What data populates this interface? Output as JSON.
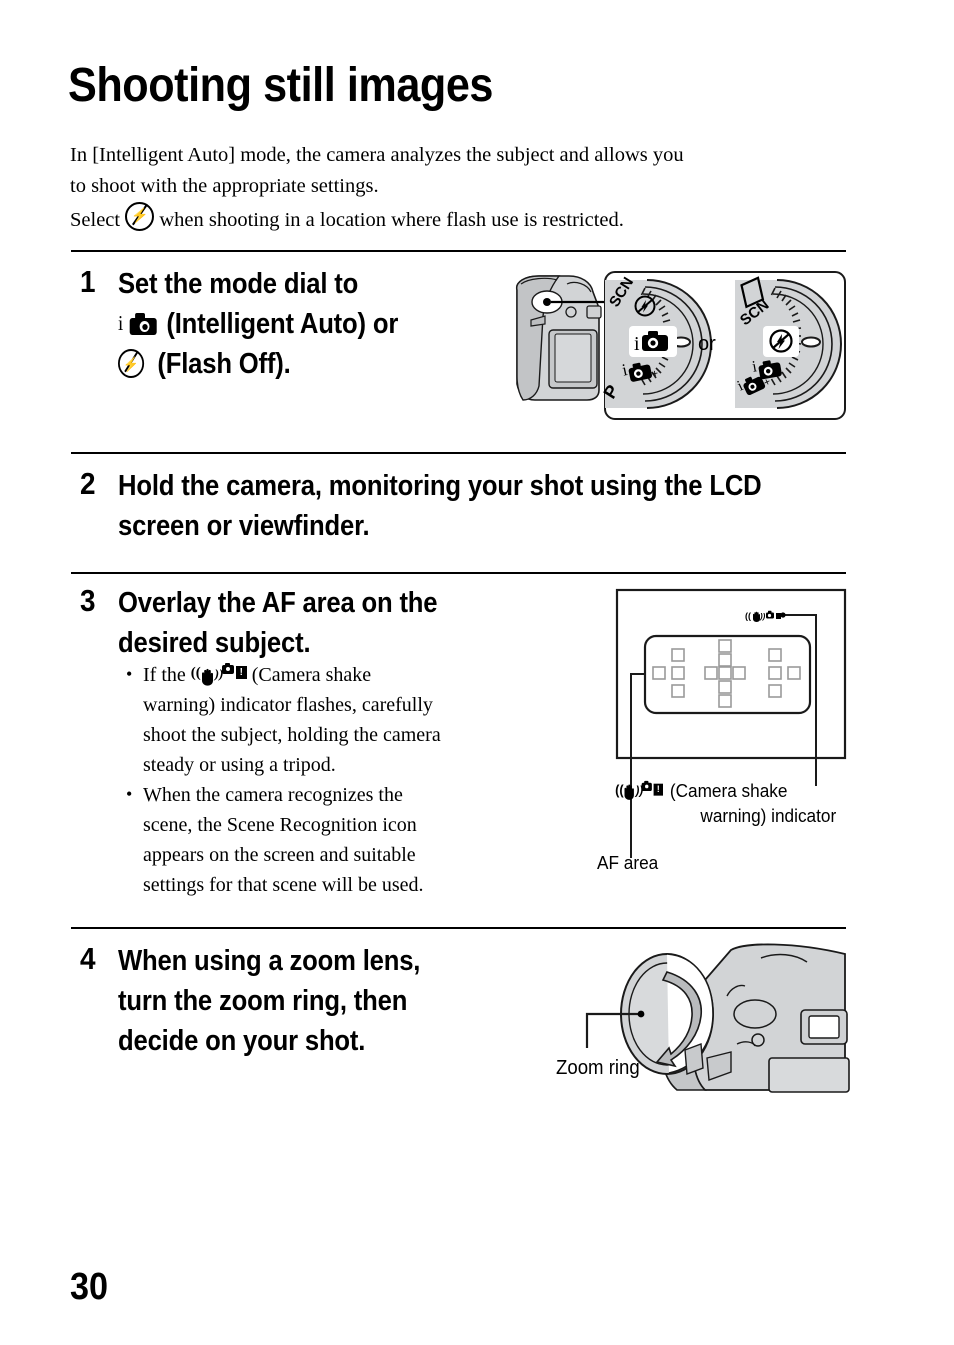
{
  "page": {
    "title": "Shooting still images",
    "number": "30"
  },
  "intro": {
    "line1": "In [Intelligent Auto] mode, the camera analyzes the subject and allows you",
    "line2": "to shoot with the appropriate settings.",
    "line3_before": "Select",
    "line3_after": "when shooting in a location where flash use is restricted.",
    "flash_off_icon": "flash-off-icon"
  },
  "steps": [
    {
      "number": "1",
      "heading_lines": [
        "Set the mode dial to",
        "(Intelligent Auto) or",
        "(Flash Off)."
      ],
      "icons": [
        "intelligent-auto-icon",
        "flash-off-icon"
      ]
    },
    {
      "number": "2",
      "heading_lines": [
        "Hold the camera, monitoring your shot using the LCD",
        "screen or viewfinder."
      ]
    },
    {
      "number": "3",
      "heading_lines": [
        "Overlay the AF area on the",
        "desired subject."
      ],
      "bullets": [
        {
          "before": "If the",
          "icon": "camera-shake-warning-icon",
          "lines": [
            "(Camera shake",
            "warning) indicator flashes, carefully",
            "shoot the subject, holding the camera",
            "steady or using a tripod."
          ]
        },
        {
          "lines": [
            "When the camera recognizes the",
            "scene, the Scene Recognition icon",
            "appears on the screen and suitable",
            "settings for that scene will be used."
          ]
        }
      ]
    },
    {
      "number": "4",
      "heading_lines": [
        "When using a zoom lens,",
        "turn the zoom ring, then",
        "decide on your shot."
      ]
    }
  ],
  "figures": {
    "mode_dial": {
      "name": "mode-dial-illustration",
      "or_label": "or",
      "left_dial_labels": [
        "SCN",
        "flash-off-icon",
        "i-auto-icon",
        "i-auto-plus-icon",
        "P"
      ],
      "right_dial_labels": [
        "panorama-icon",
        "SCN",
        "flash-off-icon",
        "i-auto-icon",
        "i-auto-plus-icon"
      ]
    },
    "af_area": {
      "name": "af-area-illustration",
      "af_area_label": "AF area",
      "shake_label_lines": [
        "(Camera shake",
        "warning) indicator"
      ],
      "shake_icon": "camera-shake-warning-icon"
    },
    "zoom_ring": {
      "name": "zoom-ring-illustration",
      "label": "Zoom ring"
    }
  },
  "colors": {
    "ink": "#000000",
    "camera_body": "#d2d4d6",
    "camera_shadow": "#bcbec0",
    "dial_fill": "#d2d4d6"
  }
}
